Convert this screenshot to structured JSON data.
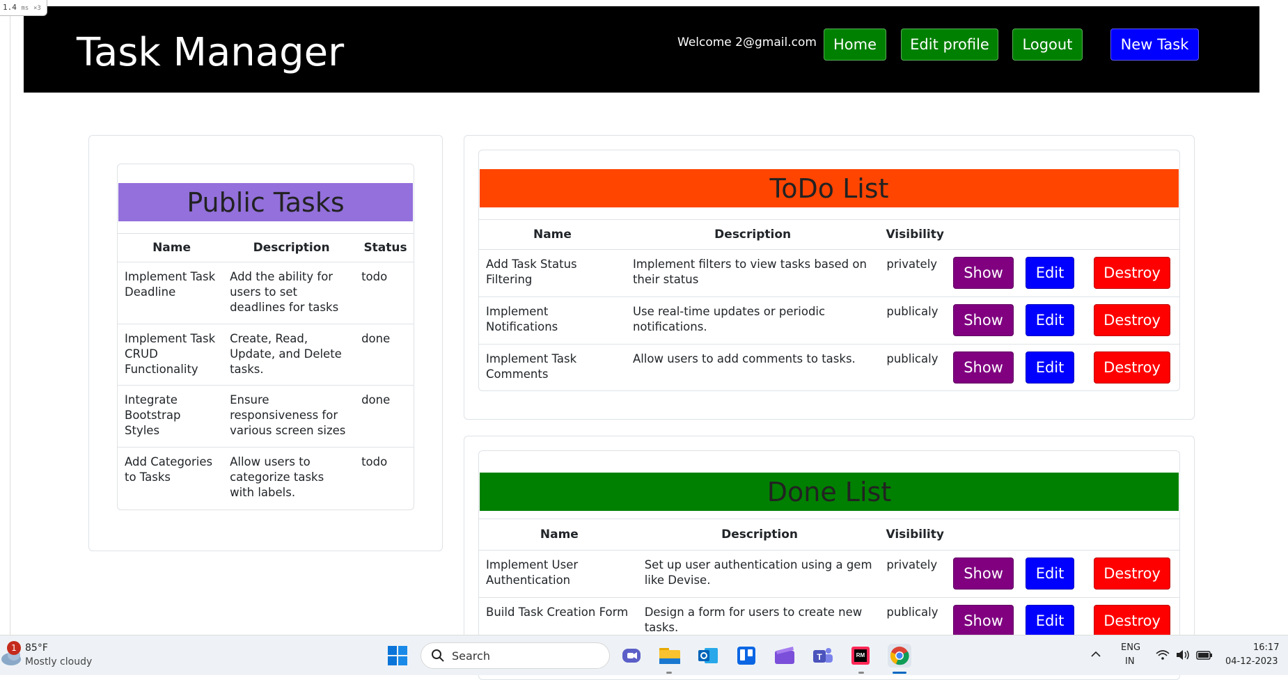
{
  "devtools_badge": {
    "value": "1.4",
    "unit": "ms",
    "mult": "×3"
  },
  "navbar": {
    "brand": "Task Manager",
    "welcome": "Welcome 2@gmail.com",
    "buttons": {
      "home": "Home",
      "edit_profile": "Edit profile",
      "logout": "Logout",
      "new_task": "New Task"
    }
  },
  "public_tasks": {
    "title": "Public Tasks",
    "columns": [
      "Name",
      "Description",
      "Status"
    ],
    "rows": [
      {
        "name": "Implement Task Deadline",
        "description": "Add the ability for users to set deadlines for tasks",
        "status": "todo"
      },
      {
        "name": "Implement Task CRUD Functionality",
        "description": "Create, Read, Update, and Delete tasks.",
        "status": "done"
      },
      {
        "name": "Integrate Bootstrap Styles",
        "description": "Ensure responsiveness for various screen sizes",
        "status": "done"
      },
      {
        "name": "Add Categories to Tasks",
        "description": "Allow users to categorize tasks with labels.",
        "status": "todo"
      }
    ]
  },
  "todo_list": {
    "title": "ToDo List",
    "columns": [
      "Name",
      "Description",
      "Visibility"
    ],
    "rows": [
      {
        "name": "Add Task Status Filtering",
        "description": "Implement filters to view tasks based on their status",
        "visibility": "privately"
      },
      {
        "name": "Implement Notifications",
        "description": "Use real-time updates or periodic notifications.",
        "visibility": "publicaly"
      },
      {
        "name": "Implement Task Comments",
        "description": "Allow users to add comments to tasks.",
        "visibility": "publicaly"
      }
    ]
  },
  "done_list": {
    "title": "Done List",
    "columns": [
      "Name",
      "Description",
      "Visibility"
    ],
    "rows": [
      {
        "name": "Implement User Authentication",
        "description": "Set up user authentication using a gem like Devise.",
        "visibility": "privately"
      },
      {
        "name": "Build Task Creation Form",
        "description": "Design a form for users to create new tasks.",
        "visibility": "publicaly"
      }
    ]
  },
  "actions": {
    "show": "Show",
    "edit": "Edit",
    "destroy": "Destroy"
  },
  "colors": {
    "public_header": "#9370db",
    "todo_header": "#ff4500",
    "done_header": "#008000",
    "show_button": "#800080",
    "edit_button": "#0000ff",
    "destroy_button": "#ff0000"
  },
  "taskbar": {
    "weather": {
      "temp": "85°F",
      "condition": "Mostly cloudy",
      "notification_count": "1"
    },
    "search_placeholder": "Search",
    "apps": [
      "windows-start-icon",
      "search-icon",
      "chat-icon",
      "file-explorer-icon",
      "outlook-icon",
      "trello-icon",
      "clipchamp-icon",
      "teams-icon",
      "rubymine-icon",
      "chrome-icon"
    ],
    "lang": "ENG",
    "region": "IN",
    "time": "16:17",
    "date": "04-12-2023"
  }
}
